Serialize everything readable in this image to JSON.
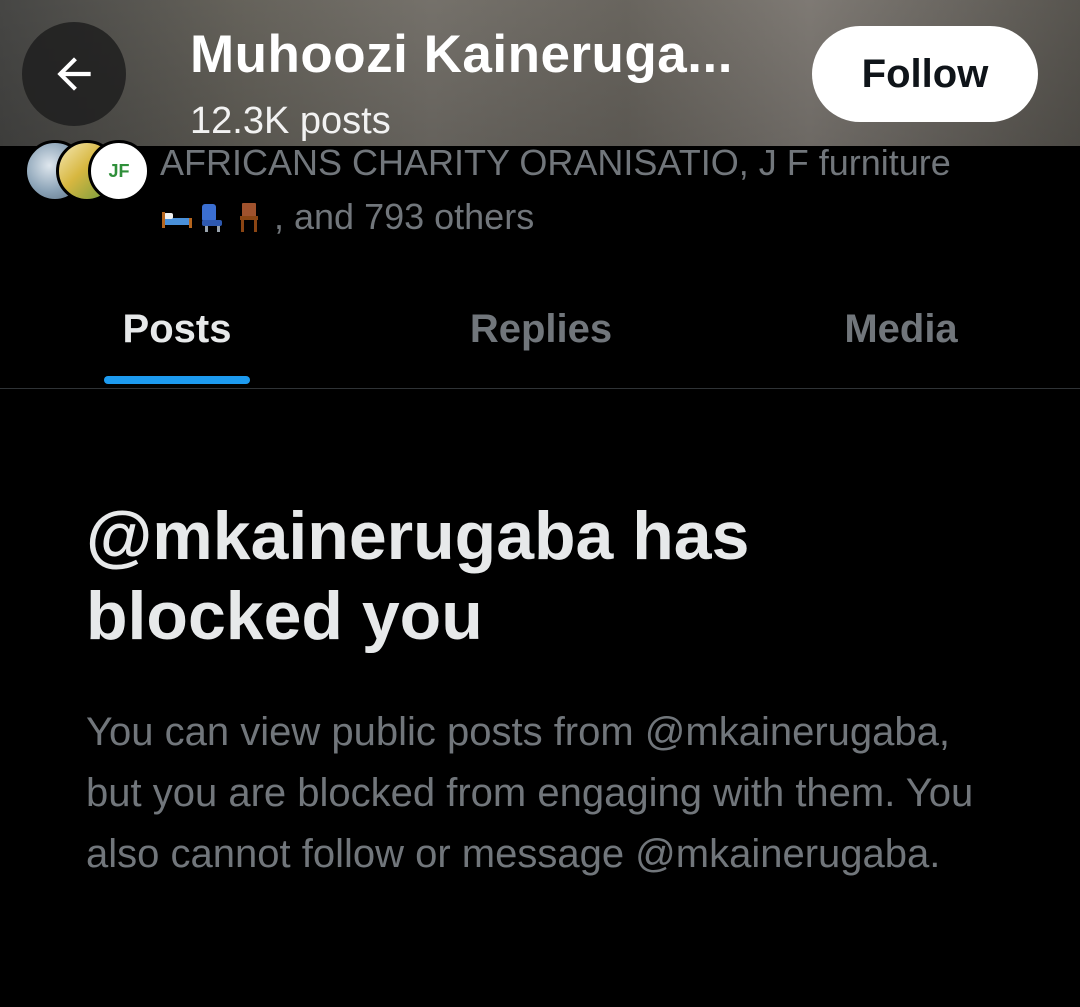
{
  "header": {
    "title": "Muhoozi Kaineruga...",
    "posts_count": "12.3K posts",
    "follow_label": "Follow",
    "back_icon": "arrow-left-icon"
  },
  "followers": {
    "line1": "AFRICANS CHARITY ORANISATIO, J F furniture",
    "line2_suffix": ", and 793 others",
    "emoji_icons": [
      "bed-icon",
      "seat-icon",
      "chair-icon"
    ],
    "avatar_badge_text": "JF"
  },
  "tabs": [
    {
      "label": "Posts",
      "active": true
    },
    {
      "label": "Replies",
      "active": false
    },
    {
      "label": "Media",
      "active": false
    }
  ],
  "blocked": {
    "title": "@mkainerugaba has blocked you",
    "body": "You can view public posts from @mkainerugaba, but you are blocked from engaging with them. You also cannot follow or message @mkainerugaba."
  },
  "colors": {
    "background": "#000000",
    "primary_text": "#e7e9ea",
    "secondary_text": "#71767b",
    "accent": "#1d9bf0",
    "follow_bg": "#ffffff"
  }
}
